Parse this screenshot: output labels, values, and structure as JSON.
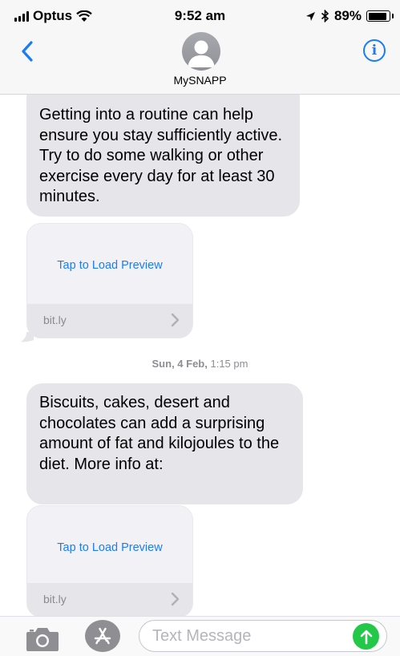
{
  "status_bar": {
    "carrier": "Optus",
    "time": "9:52 am",
    "battery": "89%",
    "battery_level": 0.89,
    "icons": [
      "signal-bars-icon",
      "wifi-icon",
      "location-arrow-icon",
      "bluetooth-icon",
      "battery-icon"
    ]
  },
  "header": {
    "contact_name": "MySNAPP",
    "icons": [
      "back-chevron-icon",
      "contact-avatar-icon",
      "info-icon"
    ],
    "info_glyph": "i"
  },
  "messages": [
    {
      "text": "Getting into a routine can help ensure you stay sufficiently active. Try to do some walking or other exercise every day for at least 30 minutes."
    },
    {
      "link_preview": {
        "tap_label": "Tap to Load Preview",
        "domain": "bit.ly"
      }
    },
    {
      "text": "Biscuits, cakes, desert and chocolates can add a surprising amount of fat and kilojoules to the diet. More info at:"
    },
    {
      "link_preview": {
        "tap_label": "Tap to Load Preview",
        "domain": "bit.ly"
      }
    }
  ],
  "timestamp": {
    "day": "Sun, 4 Feb,",
    "time": "1:15 pm"
  },
  "input_bar": {
    "placeholder": "Text Message",
    "icons": [
      "camera-icon",
      "app-store-icon",
      "send-arrow-icon"
    ]
  },
  "colors": {
    "accent_blue": "#1a7cf5",
    "bubble_gray": "#e5e5ea",
    "send_green": "#24c848",
    "timestamp_gray": "#8e8e93"
  }
}
